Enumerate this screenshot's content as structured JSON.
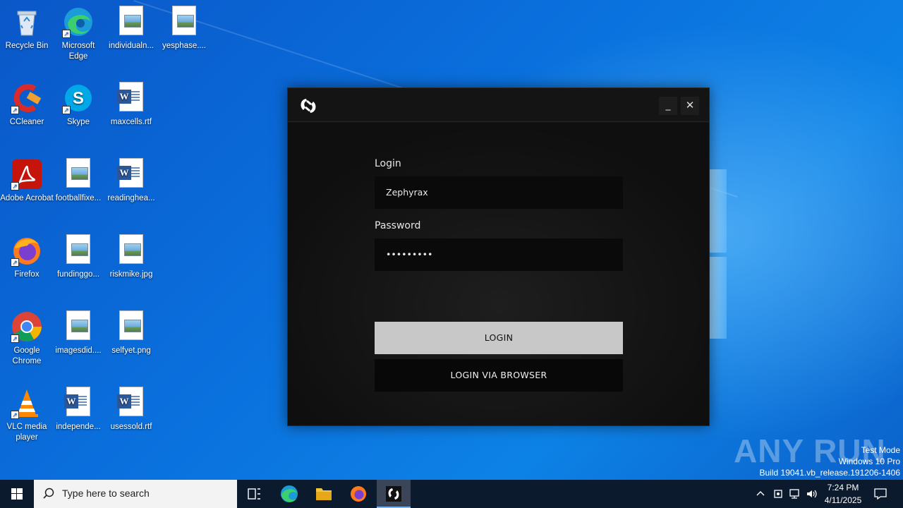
{
  "desktop": {
    "icons": [
      {
        "label": "Recycle Bin",
        "icon": "recycle-bin-icon"
      },
      {
        "label": "Microsoft Edge",
        "icon": "edge-icon"
      },
      {
        "label": "individualn...",
        "icon": "image-file-icon"
      },
      {
        "label": "yesphase....",
        "icon": "image-file-icon"
      },
      {
        "label": "CCleaner",
        "icon": "ccleaner-icon"
      },
      {
        "label": "Skype",
        "icon": "skype-icon"
      },
      {
        "label": "maxcells.rtf",
        "icon": "word-file-icon"
      },
      {
        "label": "Adobe Acrobat",
        "icon": "acrobat-icon"
      },
      {
        "label": "footballfixe...",
        "icon": "image-file-icon"
      },
      {
        "label": "readinghea...",
        "icon": "word-file-icon"
      },
      {
        "label": "Firefox",
        "icon": "firefox-icon"
      },
      {
        "label": "fundinggo...",
        "icon": "image-file-icon"
      },
      {
        "label": "riskmike.jpg",
        "icon": "image-file-icon"
      },
      {
        "label": "Google Chrome",
        "icon": "chrome-icon"
      },
      {
        "label": "imagesdid....",
        "icon": "image-file-icon"
      },
      {
        "label": "selfyet.png",
        "icon": "image-file-icon"
      },
      {
        "label": "VLC media player",
        "icon": "vlc-icon"
      },
      {
        "label": "independe...",
        "icon": "word-file-icon"
      },
      {
        "label": "usessold.rtf",
        "icon": "word-file-icon"
      }
    ]
  },
  "app_window": {
    "minimize_label": "_",
    "close_label": "✕",
    "login_label": "Login",
    "login_value": "Zephyrax",
    "password_label": "Password",
    "password_value": "•••••••••",
    "login_button": "LOGIN",
    "browser_button": "LOGIN VIA BROWSER"
  },
  "watermark": {
    "brand": "ANY RUN",
    "test_mode": "Test Mode",
    "edition": "Windows 10 Pro",
    "build": "Build 19041.vb_release.191206-1406"
  },
  "taskbar": {
    "search_placeholder": "Type here to search",
    "time": "7:24 PM",
    "date": "4/11/2025"
  },
  "colors": {
    "desktop": "#0a6fdc",
    "window_bg": "#121212",
    "login_button": "#c8c8c8",
    "taskbar": "#0c1a2e"
  }
}
